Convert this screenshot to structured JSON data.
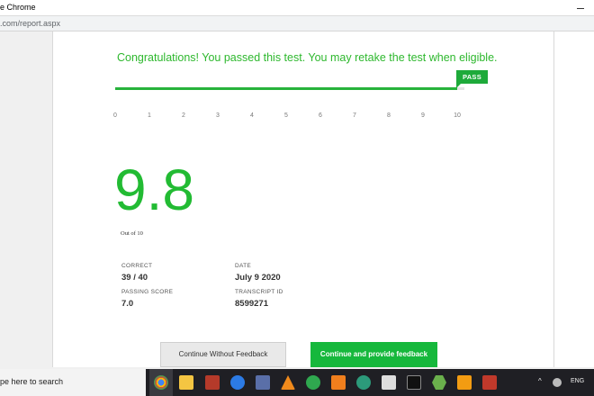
{
  "window": {
    "title": "e Chrome"
  },
  "address": {
    "url": ".com/report.aspx"
  },
  "report": {
    "message": "Congratulations! You passed this test. You may retake the test when eligible.",
    "badge": "PASS",
    "progress_fraction": 0.98,
    "ticks": [
      "0",
      "1",
      "2",
      "3",
      "4",
      "5",
      "6",
      "7",
      "8",
      "9",
      "10"
    ],
    "score": "9.8",
    "out_of": "Out of 10",
    "correct_label": "CORRECT",
    "correct_value": "39 / 40",
    "date_label": "DATE",
    "date_value": "July 9 2020",
    "passing_label": "PASSING SCORE",
    "passing_value": "7.0",
    "transcript_label": "TRANSCRIPT ID",
    "transcript_value": "8599271"
  },
  "buttons": {
    "without_feedback": "Continue Without Feedback",
    "with_feedback": "Continue and provide feedback"
  },
  "taskbar": {
    "search_text": "pe here to search",
    "language": "ENG",
    "icons": [
      "chrome-icon",
      "file-explorer-icon",
      "app-icon",
      "edge-icon",
      "calculator-icon",
      "vlc-icon",
      "app-green-icon",
      "xampp-icon",
      "app-teal-icon",
      "app-chat-icon",
      "terminal-icon",
      "app-hex-icon",
      "app-orange-icon",
      "mcafee-icon"
    ]
  },
  "colors": {
    "accent": "#22bb33",
    "button": "#16b83c",
    "taskbar": "#1f1f24"
  }
}
